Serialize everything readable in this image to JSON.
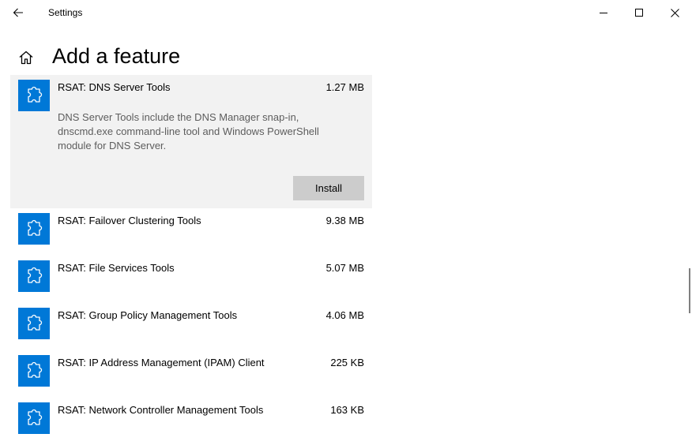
{
  "window": {
    "title": "Settings",
    "back_icon": "arrow-left-icon",
    "controls": [
      "minimize-icon",
      "maximize-icon",
      "close-icon"
    ]
  },
  "header": {
    "home_icon": "home-icon",
    "title": "Add a feature"
  },
  "features": [
    {
      "name": "RSAT: DNS Server Tools",
      "size": "1.27 MB",
      "description": "DNS Server Tools include the DNS Manager snap-in, dnscmd.exe command-line tool and Windows PowerShell module for DNS Server.",
      "install_label": "Install",
      "expanded": true,
      "icon": "puzzle-piece-icon"
    },
    {
      "name": "RSAT: Failover Clustering Tools",
      "size": "9.38 MB",
      "icon": "puzzle-piece-icon"
    },
    {
      "name": "RSAT: File Services Tools",
      "size": "5.07 MB",
      "icon": "puzzle-piece-icon"
    },
    {
      "name": "RSAT: Group Policy Management Tools",
      "size": "4.06 MB",
      "icon": "puzzle-piece-icon"
    },
    {
      "name": "RSAT: IP Address Management (IPAM) Client",
      "size": "225 KB",
      "icon": "puzzle-piece-icon"
    },
    {
      "name": "RSAT: Network Controller Management Tools",
      "size": "163 KB",
      "icon": "puzzle-piece-icon"
    }
  ],
  "colors": {
    "accent": "#0078d7",
    "expanded_background": "#f2f2f2",
    "install_button": "#cccccc",
    "description_text": "#5d5d5d"
  }
}
